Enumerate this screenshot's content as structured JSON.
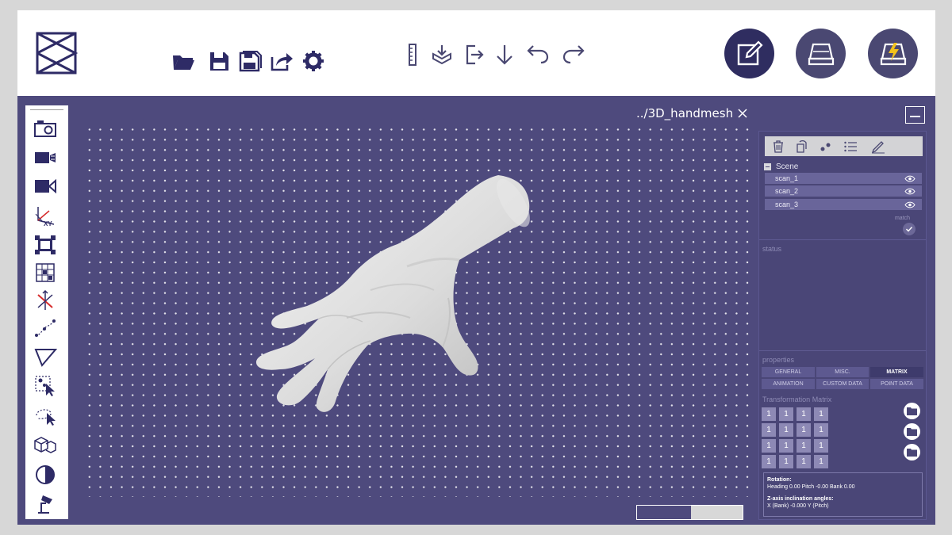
{
  "toolbar": {
    "file_icons": [
      "folder-open-icon",
      "save-icon",
      "save-all-icon",
      "export-icon",
      "settings-gear-icon"
    ],
    "tool_icons": [
      "ruler-icon",
      "import-icon",
      "exit-to-icon",
      "download-arrow-icon",
      "undo-icon",
      "redo-icon"
    ],
    "mode_buttons": [
      "edit-mode",
      "scanner-mode",
      "quick-scan-mode"
    ],
    "active_mode": "edit-mode"
  },
  "left_tools": [
    "camera-icon",
    "video-camera-icon",
    "camera-record-icon",
    "xy-axis-icon",
    "bounding-box-icon",
    "grid-icon",
    "axis-transform-icon",
    "path-points-icon",
    "triangle-icon",
    "select-points-icon",
    "lasso-select-icon",
    "cubes-icon",
    "contrast-icon",
    "light-icon"
  ],
  "viewport": {
    "file_title": "../3D_handmesh",
    "progress_fraction": 0.49
  },
  "panel": {
    "scene_label": "Scene",
    "scans": [
      {
        "label": "scan_1"
      },
      {
        "label": "scan_2"
      },
      {
        "label": "scan_3"
      }
    ],
    "match_label": "match",
    "status_label": "status",
    "properties_label": "properties",
    "tabs_row1": [
      "GENERAL",
      "MISC.",
      "MATRIX"
    ],
    "tabs_row2": [
      "ANIMATION",
      "CUSTOM DATA",
      "POINT DATA"
    ],
    "active_tab": "MATRIX",
    "transform_label": "Transformation Matrix",
    "matrix": [
      [
        "1",
        "1",
        "1",
        "1"
      ],
      [
        "1",
        "1",
        "1",
        "1"
      ],
      [
        "1",
        "1",
        "1",
        "1"
      ],
      [
        "1",
        "1",
        "1",
        "1"
      ]
    ],
    "rotation_heading": "Rotation:",
    "rotation_text": "Heading 0.00 Pitch -0.00 Bank 0.00",
    "z_heading": "Z-axis inclination angles:",
    "z_text": "X (Bank) -0.000 Y (Pitch)"
  },
  "colors": {
    "viewport_bg": "#4e4a7d",
    "mode_active": "#2f2d60",
    "mode_inactive": "#4a4872"
  }
}
